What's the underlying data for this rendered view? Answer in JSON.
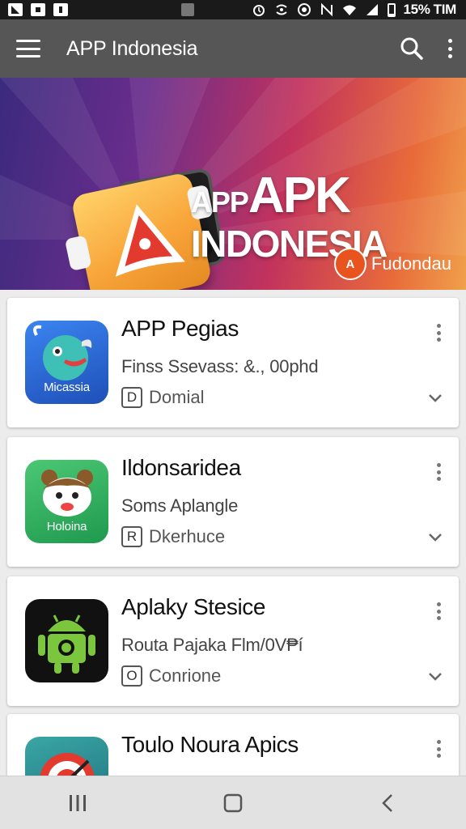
{
  "status_bar": {
    "battery_text": "15%",
    "carrier": "TIM"
  },
  "app_bar": {
    "title": "APP Indonesia",
    "icons": [
      "menu-icon",
      "search-icon",
      "more-vert-icon"
    ]
  },
  "banner": {
    "line1_small": "APP",
    "line1_big": "APK",
    "line2": "INDONESIA",
    "brand_logo_text": "A",
    "brand_name": "Fudondau"
  },
  "apps": [
    {
      "title": "APP Pegias",
      "subtitle": "Finss Ssevass: &., 00phd",
      "tag_icon": "D",
      "tag": "Domial",
      "icon_label": "Micassia",
      "icon_color": "#2f6fd8"
    },
    {
      "title": "Ildonsaridea",
      "subtitle": "Soms Aplangle",
      "tag_icon": "R",
      "tag": "Dkerhuce",
      "icon_label": "Holoina",
      "icon_color": "#35b560"
    },
    {
      "title": "Aplaky Stesice",
      "subtitle": "Routa Pajaka Flm/0V₱í",
      "tag_icon": "O",
      "tag": "Conrione",
      "icon_label": "",
      "icon_color": "#111111"
    },
    {
      "title": "Toulo Noura Apics",
      "subtitle": "",
      "tag_icon": "",
      "tag": "",
      "icon_label": "",
      "icon_color": "#2a8a8a"
    }
  ],
  "nav_bar": {
    "icons": [
      "recents-icon",
      "home-icon",
      "back-icon"
    ]
  }
}
